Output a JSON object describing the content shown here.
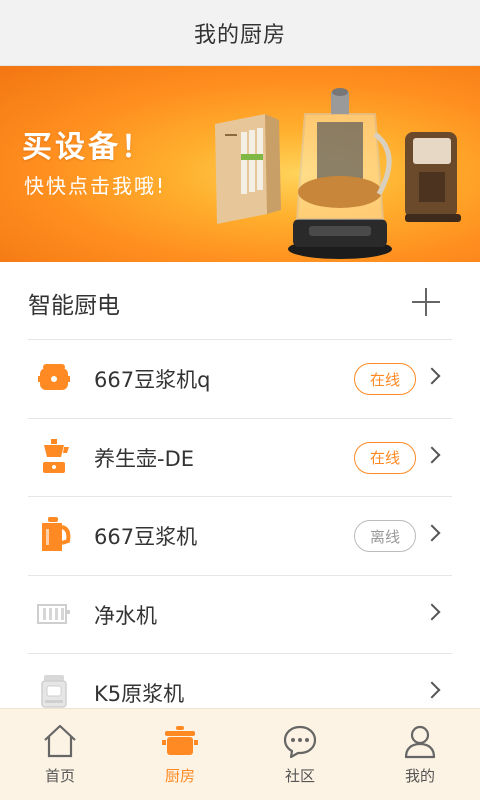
{
  "header": {
    "title": "我的厨房"
  },
  "banner": {
    "headline": "买设备！",
    "subline": "快快点击我哦!"
  },
  "section": {
    "title": "智能厨电"
  },
  "devices": [
    {
      "name": "667豆浆机q",
      "status": "在线",
      "icon": "rice-cooker-icon"
    },
    {
      "name": "养生壶-DE",
      "status": "在线",
      "icon": "health-pot-icon"
    },
    {
      "name": "667豆浆机",
      "status": "离线",
      "icon": "soymilk-maker-icon"
    },
    {
      "name": "净水机",
      "status": "",
      "icon": "water-purifier-icon"
    },
    {
      "name": "K5原浆机",
      "status": "",
      "icon": "juicer-icon"
    }
  ],
  "tabs": [
    {
      "label": "首页",
      "icon": "home-icon"
    },
    {
      "label": "厨房",
      "icon": "pot-icon",
      "active": true
    },
    {
      "label": "社区",
      "icon": "chat-bubble-icon"
    },
    {
      "label": "我的",
      "icon": "user-icon"
    }
  ],
  "colors": {
    "accent": "#ff8a24",
    "offline": "#999999",
    "tabbar_bg": "#fdf3e4",
    "header_bg": "#f2f2f2"
  }
}
